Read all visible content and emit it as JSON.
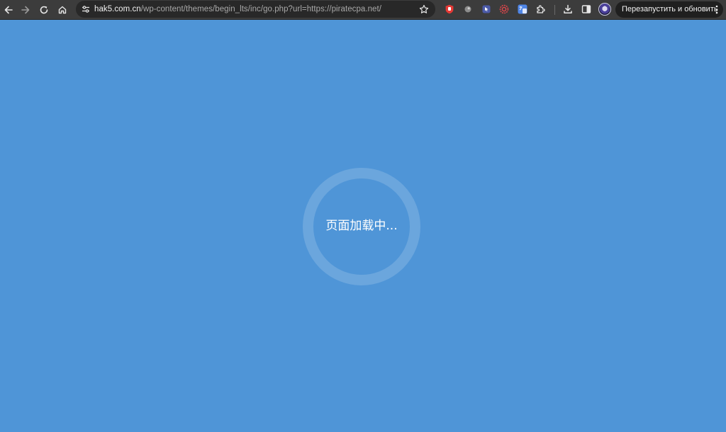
{
  "browser": {
    "url_host": "hak5.com.cn",
    "url_path": "/wp-content/themes/begin_lts/inc/go.php?url=https://piratecpa.net/",
    "relaunch_label": "Перезапустить и обновить",
    "icons": {
      "back": "back-arrow-icon",
      "forward": "forward-arrow-icon",
      "reload": "reload-icon",
      "home": "home-icon",
      "site_info": "tune-icon",
      "bookmark": "star-icon",
      "download": "download-icon",
      "side_panel": "side-panel-icon",
      "menu": "kebab-menu-icon"
    },
    "extensions": [
      {
        "name": "red-hand-extension-icon",
        "color": "#e53935"
      },
      {
        "name": "grey-disc-extension-icon",
        "color": "#9e9e9e"
      },
      {
        "name": "cursor-extension-icon",
        "color": "#5b6bbf"
      },
      {
        "name": "red-spiral-extension-icon",
        "color": "#e0464b"
      },
      {
        "name": "translate-extension-icon",
        "color": "#4f86e8"
      },
      {
        "name": "puzzle-extensions-icon",
        "color": "#e8e8e8"
      }
    ]
  },
  "page": {
    "background": "#4f95d7",
    "loading_text": "页面加载中..."
  }
}
